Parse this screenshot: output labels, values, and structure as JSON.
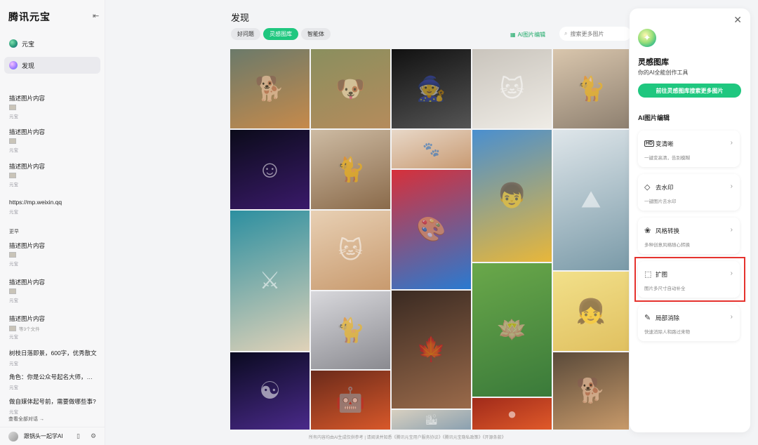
{
  "app": {
    "brand": "腾讯元宝",
    "collapse_icon": "collapse-sidebar-icon"
  },
  "sidebar": {
    "nav": [
      {
        "label": "元宝",
        "icon": "yuanbao-logo-icon"
      },
      {
        "label": "发现",
        "icon": "discover-icon",
        "active": true
      }
    ],
    "history": [
      {
        "title": "描述图片内容",
        "sub": "元宝"
      },
      {
        "title": "描述图片内容",
        "sub": "元宝"
      },
      {
        "title": "描述图片内容",
        "sub": "元宝"
      },
      {
        "title": "https://mp.weixin.qq",
        "sub": "元宝"
      }
    ],
    "earlier_label": "更早",
    "earlier": [
      {
        "title": "描述图片内容",
        "sub": "元宝",
        "extra": ""
      },
      {
        "title": "描述图片内容",
        "sub": "元宝",
        "extra": ""
      },
      {
        "title": "描述图片内容",
        "sub": "元宝",
        "extra": "等3个文件"
      },
      {
        "title": "树枝日落即景，600字，优秀散文",
        "sub": "元宝",
        "extra": ""
      },
      {
        "title": "角色：你是公众号起名大师，已...",
        "sub": "元宝",
        "extra": ""
      },
      {
        "title": "做自媒体起号前，需要做哪些事?",
        "sub": "元宝",
        "extra": ""
      }
    ],
    "view_all": "查看全部对话 →",
    "user_name": "跟锅头一起学AI"
  },
  "main": {
    "title": "发现",
    "tabs": [
      {
        "label": "好问题"
      },
      {
        "label": "灵感图库",
        "active": true
      },
      {
        "label": "智能体"
      }
    ],
    "ai_edit_label": "AI图片编辑",
    "search_placeholder": "搜索更多图片",
    "footer_note": "所有内容均由AI生成仅供参考 | 请阅读并知悉《腾讯元宝用户服务协议》《腾讯元宝隐私政策》《开源条款》"
  },
  "gallery": {
    "images": [
      {
        "name": "shiba-in-hat",
        "icon": "🐕",
        "colors": [
          "#6b7a6a",
          "#c68a4b"
        ]
      },
      {
        "name": "smiling-dog",
        "icon": "🐶",
        "colors": [
          "#8a8f5e",
          "#b58b5c"
        ]
      },
      {
        "name": "witch-girl-sketch",
        "icon": "🧙",
        "colors": [
          "#111",
          "#555"
        ]
      },
      {
        "name": "cat-in-hood",
        "icon": "🐱",
        "colors": [
          "#c9c4bc",
          "#efece6"
        ]
      },
      {
        "name": "cat-with-bow",
        "icon": "🐈",
        "colors": [
          "#d9c6ad",
          "#8e8070"
        ]
      },
      {
        "name": "neon-smiley",
        "icon": "☺",
        "colors": [
          "#0b0b1a",
          "#3a1a6a"
        ]
      },
      {
        "name": "bengal-cat-scarf",
        "icon": "🐈",
        "colors": [
          "#cdbba3",
          "#8a6a4a"
        ]
      },
      {
        "name": "puppies-pile",
        "icon": "🐾",
        "colors": [
          "#e8d8c8",
          "#c89a72"
        ]
      },
      {
        "name": "boy-yellow-hoodie",
        "icon": "👦",
        "colors": [
          "#4a8fcf",
          "#e8b73a"
        ]
      },
      {
        "name": "mountain-temple",
        "icon": "⛰",
        "colors": [
          "#dfe6ea",
          "#7a9aa8"
        ]
      },
      {
        "name": "graffiti-art",
        "icon": "🎨",
        "colors": [
          "#d7303a",
          "#2a7ad0"
        ]
      },
      {
        "name": "samurai-clouds",
        "icon": "⚔",
        "colors": [
          "#2c8fa0",
          "#e0d2b8"
        ]
      },
      {
        "name": "scottish-fold",
        "icon": "🐱",
        "colors": [
          "#e8d0b4",
          "#c89a6e"
        ]
      },
      {
        "name": "lotus-green",
        "icon": "🪷",
        "colors": [
          "#6aa84a",
          "#3a7a3a"
        ]
      },
      {
        "name": "girl-illustration",
        "icon": "👧",
        "colors": [
          "#f2e08a",
          "#e0c060"
        ]
      },
      {
        "name": "fluffy-cat",
        "icon": "🐈",
        "colors": [
          "#d8d8dc",
          "#8a8a90"
        ]
      },
      {
        "name": "autumn-leaf",
        "icon": "🍁",
        "colors": [
          "#3a2a22",
          "#9a6a4a"
        ]
      },
      {
        "name": "cosmic-swirl",
        "icon": "☯",
        "colors": [
          "#0a0a20",
          "#4a2a8a"
        ]
      },
      {
        "name": "robot-head",
        "icon": "🤖",
        "colors": [
          "#6a2a1a",
          "#d8582a"
        ]
      },
      {
        "name": "red-planet",
        "icon": "●",
        "colors": [
          "#a02a1a",
          "#e05a2a"
        ]
      },
      {
        "name": "city-signs",
        "icon": "🏙",
        "colors": [
          "#d8d0c0",
          "#8aa0b0"
        ]
      },
      {
        "name": "happy-dog",
        "icon": "🐕",
        "colors": [
          "#5a4a3a",
          "#c89a6a"
        ]
      }
    ]
  },
  "panel": {
    "title": "灵感图库",
    "subtitle": "你的AI全能创作工具",
    "cta": "前往灵感图库搜索更多图片",
    "section": "AI图片编辑",
    "tools": [
      {
        "label": "变清晰",
        "desc": "一键变高清，告别模糊",
        "icon": "hd-icon",
        "glyph": "HD"
      },
      {
        "label": "去水印",
        "desc": "一键图片去水印",
        "icon": "eraser-icon",
        "glyph": "◇"
      },
      {
        "label": "风格转换",
        "desc": "多种创意风格随心转换",
        "icon": "style-icon",
        "glyph": "❀"
      },
      {
        "label": "扩图",
        "desc": "图片多尺寸自动补全",
        "icon": "expand-icon",
        "glyph": "⬚"
      },
      {
        "label": "局部消除",
        "desc": "快速消除人和路过来物",
        "icon": "brush-icon",
        "glyph": "✎"
      }
    ]
  }
}
